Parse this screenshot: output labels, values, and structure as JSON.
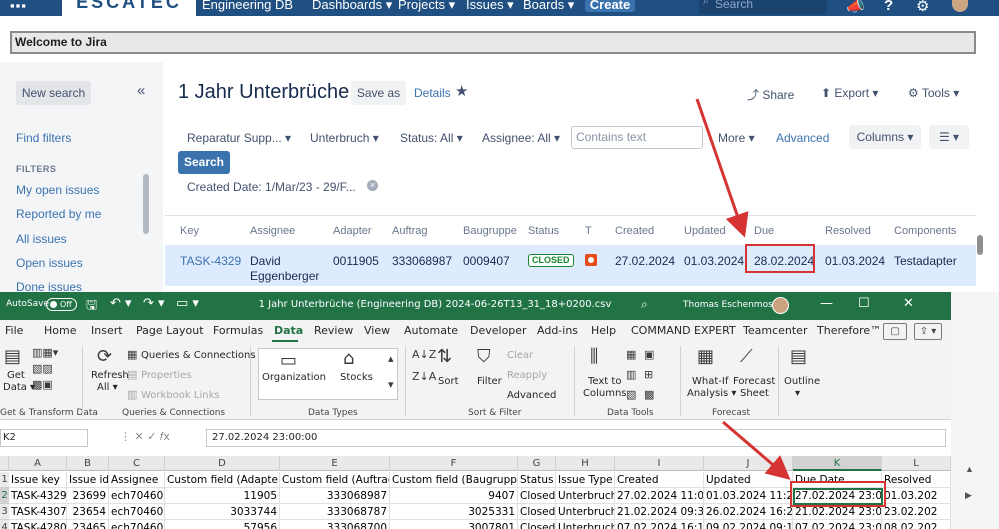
{
  "topnav": {
    "logo_text": "ESCATEC",
    "project_name": "Engineering DB",
    "dashboards": "Dashboards ▾",
    "projects": "Projects ▾",
    "issues": "Issues ▾",
    "boards": "Boards ▾",
    "create": "Create",
    "search_placeholder": "Search",
    "apps_glyph": "▪▪▪",
    "bell_glyph": "📣",
    "help_glyph": "?",
    "settings_glyph": "⚙"
  },
  "welcome": "Welcome to Jira",
  "sidebar": {
    "new_search": "New search",
    "collapse_glyph": "«",
    "find_filters": "Find filters",
    "filters_heading": "FILTERS",
    "items": [
      "My open issues",
      "Reported by me",
      "All issues",
      "Open issues",
      "Done issues"
    ]
  },
  "filter": {
    "title": "1 Jahr Unterbrüche",
    "save_as": "Save as",
    "details": "Details",
    "star_glyph": "★",
    "share": "⤴ Share",
    "export": "⬆ Export ▾",
    "tools": "⚙ Tools ▾"
  },
  "criteria": {
    "project": "Reparatur Supp... ▾",
    "type": "Unterbruch ▾",
    "status": "Status: All ▾",
    "assignee": "Assignee: All ▾",
    "contains_placeholder": "Contains text",
    "more": "More ▾",
    "advanced": "Advanced",
    "columns": "Columns ▾",
    "view_glyph": "☰ ▾",
    "search": "Search",
    "created_date": "Created Date: 1/Mar/23 - 29/F...",
    "clear_glyph": "×"
  },
  "issue_table": {
    "headers": [
      "Key",
      "Assignee",
      "Adapter",
      "Auftrag",
      "Baugruppe",
      "Status",
      "T",
      "Created",
      "Updated",
      "Due",
      "Resolved",
      "Components"
    ],
    "row": {
      "key": "TASK-4329",
      "assignee_line1": "David",
      "assignee_line2": "Eggenberger",
      "adapter": "0011905",
      "auftrag": "333068987",
      "baugruppe": "0009407",
      "status": "CLOSED",
      "created": "27.02.2024",
      "updated": "01.03.2024",
      "due": "28.02.2024",
      "resolved": "01.03.2024",
      "components": "Testadapter"
    }
  },
  "excel": {
    "autosave_label": "AutoSave",
    "autosave_state": "Off",
    "save_glyph": "🖫",
    "undo_glyph": "↶ ▾",
    "redo_glyph": "↷ ▾",
    "extra_glyph": "▭ ▾",
    "filename": "1 Jahr Unterbrüche (Engineering DB) 2024-06-26T13_31_18+0200.csv",
    "search_glyph": "⌕",
    "user_name": "Thomas Eschenmoser",
    "minimize": "—",
    "restore": "☐",
    "close": "✕",
    "tabs": [
      "File",
      "Home",
      "Insert",
      "Page Layout",
      "Formulas",
      "Data",
      "Review",
      "View",
      "Automate",
      "Developer",
      "Add-ins",
      "Help",
      "COMMAND EXPERT",
      "Teamcenter",
      "Therefore™"
    ],
    "comments_glyph": "▢",
    "share_glyph": "⇪ ▾",
    "ribbon": {
      "get_data_1": "Get",
      "get_data_2": "Data ▾",
      "refresh_1": "Refresh",
      "refresh_2": "All ▾",
      "queries_connections": "Queries & Connections",
      "properties": "Properties",
      "workbook_links": "Workbook Links",
      "organization": "Organization",
      "stocks": "Stocks",
      "sort": "Sort",
      "filter": "Filter",
      "clear": "Clear",
      "reapply": "Reapply",
      "advanced": "Advanced",
      "text_to_columns_1": "Text to",
      "text_to_columns_2": "Columns",
      "what_if_1": "What-If",
      "what_if_2": "Analysis ▾",
      "forecast_sheet_1": "Forecast",
      "forecast_sheet_2": "Sheet",
      "outline": "Outline",
      "outline_arrow": "▾",
      "groups": {
        "get_transform": "Get & Transform Data",
        "queries": "Queries & Connections",
        "data_types": "Data Types",
        "sort_filter": "Sort & Filter",
        "data_tools": "Data Tools",
        "forecast": "Forecast"
      }
    },
    "name_box": "K2",
    "fx_buttons": "⋮   ✕   ✓   𝑓x",
    "formula": "27.02.2024 23:00:00",
    "columns": [
      "A",
      "B",
      "C",
      "D",
      "E",
      "F",
      "G",
      "H",
      "I",
      "J",
      "K",
      "L"
    ],
    "rows": [
      {
        "num": "1",
        "cells": [
          "Issue key",
          "Issue id",
          "Assignee",
          "Custom field (Adapter)",
          "Custom field (Auftrag)",
          "Custom field (Baugruppe)",
          "Status",
          "Issue Type",
          "Created",
          "Updated",
          "Due Date",
          "Resolved"
        ]
      },
      {
        "num": "2",
        "cells": [
          "TASK-4329",
          "23699",
          "ech70460",
          "11905",
          "333068987",
          "9407",
          "Closed",
          "Unterbruch",
          "27.02.2024 11:08",
          "01.03.2024 11:26",
          "27.02.2024 23:00",
          "01.03.202"
        ]
      },
      {
        "num": "3",
        "cells": [
          "TASK-4307",
          "23654",
          "ech70460",
          "3033744",
          "333068787",
          "3025331",
          "Closed",
          "Unterbruch",
          "21.02.2024 09:30",
          "26.02.2024 16:20",
          "21.02.2024 23:00",
          "23.02.202"
        ]
      },
      {
        "num": "4",
        "cells": [
          "TASK-4280",
          "23465",
          "ech70460",
          "57956",
          "333068700",
          "3007801",
          "Closed",
          "Unterbruch",
          "07.02.2024 16:12",
          "09.02.2024 09:15",
          "07.02.2024 23:00",
          "08.02.202"
        ]
      }
    ]
  },
  "colors": {
    "jira_nav": "#205081",
    "jira_link": "#3b73af",
    "excel_green": "#217346",
    "highlight_red": "#d63333"
  }
}
